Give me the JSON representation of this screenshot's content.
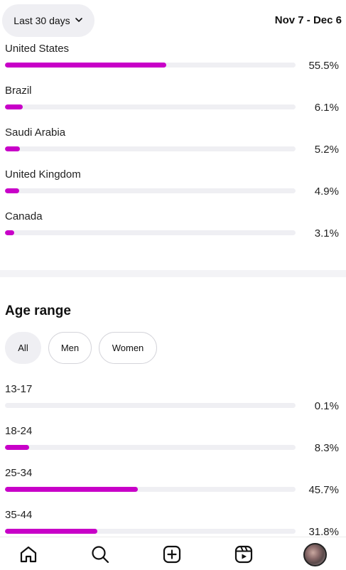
{
  "header": {
    "range_label": "Last 30 days",
    "date_range": "Nov 7 - Dec 6"
  },
  "countries": [
    {
      "name": "United States",
      "percent": "55.5%",
      "value": 55.5
    },
    {
      "name": "Brazil",
      "percent": "6.1%",
      "value": 6.1
    },
    {
      "name": "Saudi Arabia",
      "percent": "5.2%",
      "value": 5.2
    },
    {
      "name": "United Kingdom",
      "percent": "4.9%",
      "value": 4.9
    },
    {
      "name": "Canada",
      "percent": "3.1%",
      "value": 3.1
    }
  ],
  "age_section": {
    "title": "Age range",
    "filters": [
      "All",
      "Men",
      "Women"
    ],
    "selected": "All",
    "ranges": [
      {
        "name": "13-17",
        "percent": "0.1%",
        "value": 0.1
      },
      {
        "name": "18-24",
        "percent": "8.3%",
        "value": 8.3
      },
      {
        "name": "25-34",
        "percent": "45.7%",
        "value": 45.7
      },
      {
        "name": "35-44",
        "percent": "31.8%",
        "value": 31.8
      }
    ]
  },
  "colors": {
    "bar_fill": "#c800c8",
    "bar_track": "#efeff3",
    "chip_active_bg": "#efeff3"
  },
  "nav": {
    "items": [
      "home-icon",
      "search-icon",
      "create-icon",
      "reels-icon",
      "profile-avatar"
    ]
  }
}
